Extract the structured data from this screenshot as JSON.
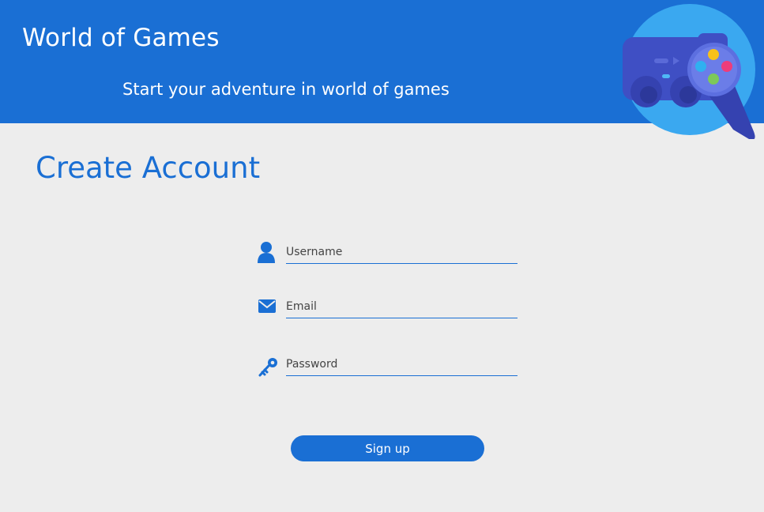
{
  "header": {
    "title": "World of Games",
    "subtitle": "Start your adventure in world of games",
    "logo_icon": "gamepad-icon"
  },
  "form": {
    "title": "Create Account",
    "fields": [
      {
        "icon": "user-icon",
        "placeholder": "Username",
        "value": ""
      },
      {
        "icon": "envelope-icon",
        "placeholder": "Email",
        "value": ""
      },
      {
        "icon": "key-icon",
        "placeholder": "Password",
        "value": ""
      }
    ],
    "submit_label": "Sign up"
  },
  "colors": {
    "primary": "#1a6fd4",
    "background": "#ededed",
    "logo_circle": "#3aa8f0",
    "logo_controller": "#3f4fc4"
  }
}
